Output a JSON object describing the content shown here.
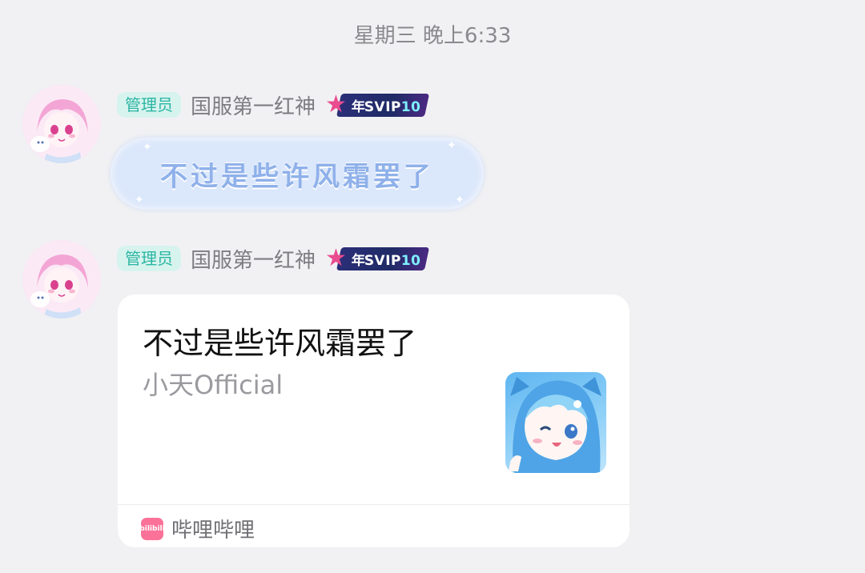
{
  "timestamp": "星期三 晚上6:33",
  "messages": [
    {
      "role": "管理员",
      "sender": "国服第一红神",
      "vip_prefix": "年",
      "vip_label": "SVIP",
      "vip_level": "10",
      "text": "不过是些许风霜罢了"
    },
    {
      "role": "管理员",
      "sender": "国服第一红神",
      "vip_prefix": "年",
      "vip_label": "SVIP",
      "vip_level": "10",
      "card": {
        "title": "不过是些许风霜罢了",
        "author": "小天Official",
        "source": "哔哩哔哩",
        "source_icon_text": "bilibili"
      }
    }
  ],
  "colors": {
    "role_badge_bg": "#d7f3ee",
    "role_badge_text": "#2bb6a3",
    "bubble_bg": "#dbe7fb",
    "bubble_text": "#8fb1ea",
    "bilibili_pink": "#fb7299"
  },
  "icons": [
    "avatar-anime-girl",
    "svip-star-icon",
    "bilibili-logo-icon",
    "video-thumbnail"
  ]
}
